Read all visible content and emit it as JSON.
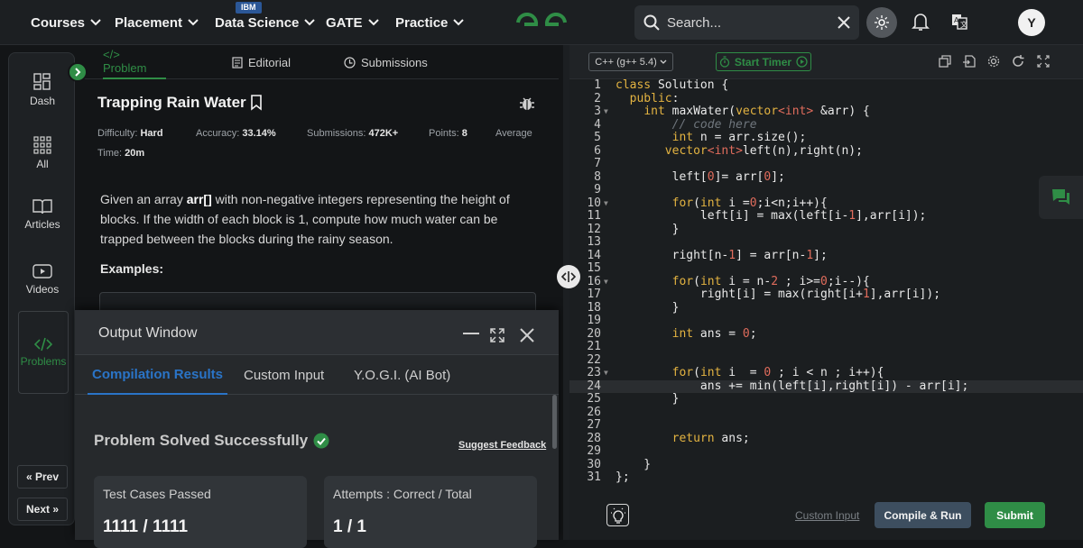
{
  "nav": {
    "items": [
      "Courses",
      "Placement",
      "Data Science",
      "GATE",
      "Practice"
    ],
    "badge": "IBM",
    "search_placeholder": "Search...",
    "avatar_initial": "Y"
  },
  "rail": {
    "items": [
      "Dash",
      "All",
      "Articles",
      "Videos",
      "Problems"
    ],
    "prev": "« Prev",
    "next": "Next »"
  },
  "problem": {
    "tabs": [
      "</> Problem",
      "Editorial",
      "Submissions"
    ],
    "title": "Trapping Rain Water",
    "difficulty_label": "Difficulty:",
    "difficulty": "Hard",
    "accuracy_label": "Accuracy:",
    "accuracy": "33.14%",
    "submissions_label": "Submissions:",
    "submissions": "472K+",
    "points_label": "Points:",
    "points": "8",
    "average_label": "Average",
    "time_label": "Time:",
    "time": "20m",
    "desc_1": "Given an array ",
    "desc_arr": "arr[]",
    "desc_2": " with non-negative integers representing the height of blocks. If the width of each block is 1, compute how much water can be trapped between the blocks during the rainy season.",
    "examples": "Examples:"
  },
  "output": {
    "title": "Output Window",
    "tabs": [
      "Compilation Results",
      "Custom Input",
      "Y.O.G.I. (AI Bot)"
    ],
    "status": "Problem Solved Successfully",
    "feedback": "Suggest Feedback",
    "cards": [
      {
        "label": "Test Cases Passed",
        "value": "1111 / 1111"
      },
      {
        "label": "Attempts : Correct / Total",
        "value": "1 / 1"
      }
    ]
  },
  "editor": {
    "language": "C++ (g++ 5.4)",
    "timer": "Start Timer",
    "custom_input": "Custom Input",
    "compile": "Compile & Run",
    "submit": "Submit",
    "highlighted_line": 24,
    "lines": [
      "class Solution {",
      "  public:",
      "    int maxWater(vector<int> &arr) {",
      "        // code here",
      "        int n = arr.size();",
      "       vector<int>left(n),right(n);",
      "",
      "        left[0]= arr[0];",
      "",
      "        for(int i =0;i<n;i++){",
      "            left[i] = max(left[i-1],arr[i]);",
      "        }",
      "",
      "        right[n-1] = arr[n-1];",
      "",
      "        for(int i = n-2 ; i>=0;i--){",
      "            right[i] = max(right[i+1],arr[i]);",
      "        }",
      "",
      "        int ans = 0;",
      "",
      "",
      "        for(int i  = 0 ; i < n ; i++){",
      "            ans += min(left[i],right[i]) - arr[i];",
      "        }",
      "",
      "",
      "        return ans;",
      "",
      "    }",
      "};"
    ]
  },
  "colors": {
    "accent": "#2f8d46",
    "blue_tab": "#2a74c7",
    "bg": "#131517"
  }
}
